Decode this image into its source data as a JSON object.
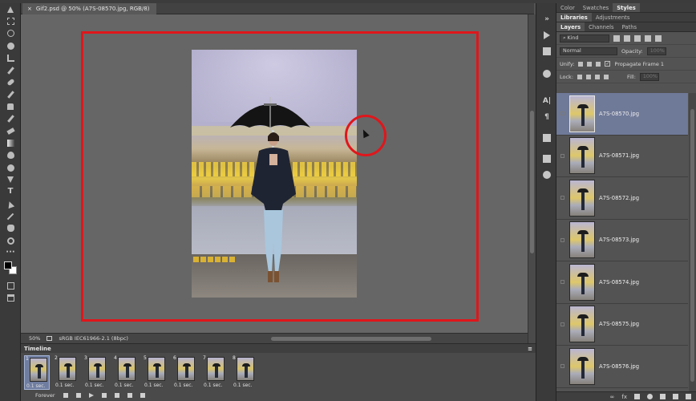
{
  "document": {
    "tab_title": "Gif2.psd @ 50% (A7S-08570.jpg, RGB/8)",
    "close_symbol": "×"
  },
  "status": {
    "zoom": "50%",
    "color_profile": "sRGB IEC61966-2.1 (8bpc)"
  },
  "timeline": {
    "title": "Timeline",
    "loop": "Forever",
    "frames": [
      {
        "num": "1",
        "duration": "0.1 sec."
      },
      {
        "num": "2",
        "duration": "0.1 sec."
      },
      {
        "num": "3",
        "duration": "0.1 sec."
      },
      {
        "num": "4",
        "duration": "0.1 sec."
      },
      {
        "num": "5",
        "duration": "0.1 sec."
      },
      {
        "num": "6",
        "duration": "0.1 sec."
      },
      {
        "num": "7",
        "duration": "0.1 sec."
      },
      {
        "num": "8",
        "duration": "0.1 sec."
      }
    ]
  },
  "panels": {
    "top_tabs": [
      "Color",
      "Swatches",
      "Styles"
    ],
    "mid_tabs": [
      "Libraries",
      "Adjustments"
    ],
    "layer_tabs": [
      "Layers",
      "Channels",
      "Paths"
    ],
    "filter_kind": "Kind",
    "blend_mode": "Normal",
    "opacity_label": "Opacity:",
    "opacity_value": "100%",
    "unify_label": "Unify:",
    "propagate_label": "Propagate Frame 1",
    "lock_label": "Lock:",
    "fill_label": "Fill:",
    "fill_value": "100%"
  },
  "layers": [
    {
      "name": "A7S-08570.jpg",
      "selected": true
    },
    {
      "name": "A7S-08571.jpg",
      "selected": false
    },
    {
      "name": "A7S-08572.jpg",
      "selected": false
    },
    {
      "name": "A7S-08573.jpg",
      "selected": false
    },
    {
      "name": "A7S-08574.jpg",
      "selected": false
    },
    {
      "name": "A7S-08575.jpg",
      "selected": false
    },
    {
      "name": "A7S-08576.jpg",
      "selected": false
    }
  ],
  "colors": {
    "highlight_red": "#e0161b",
    "selection_blue": "#6f7998",
    "canvas_gray": "#666666"
  }
}
